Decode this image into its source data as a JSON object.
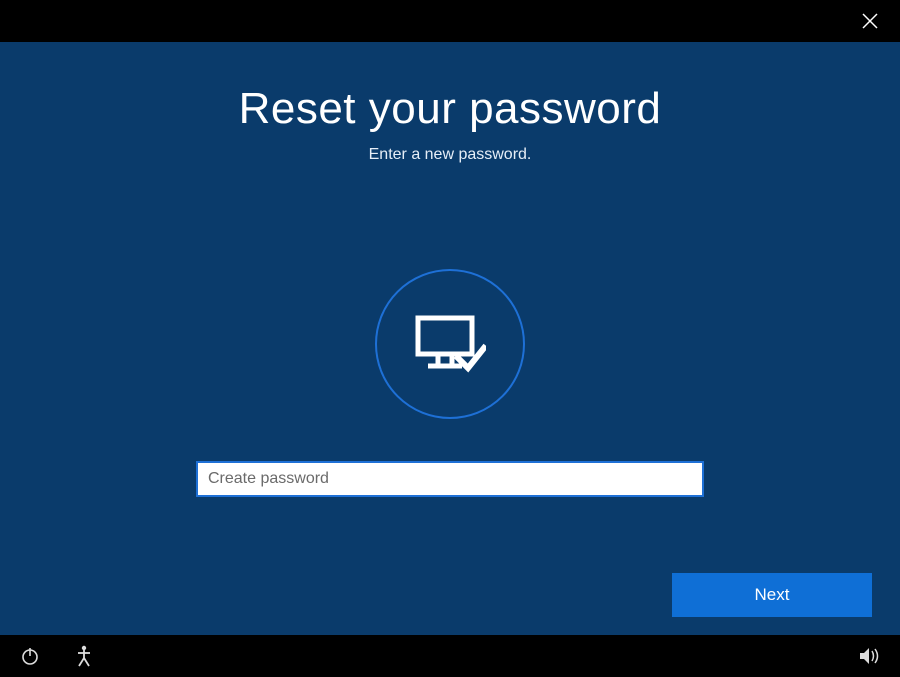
{
  "header": {
    "close_icon": "close-icon"
  },
  "main": {
    "title": "Reset your password",
    "subtitle": "Enter a new password.",
    "password_placeholder": "Create password",
    "password_value": "",
    "next_label": "Next"
  },
  "footer": {
    "power_icon": "power-icon",
    "accessibility_icon": "accessibility-icon",
    "volume_icon": "volume-icon"
  }
}
